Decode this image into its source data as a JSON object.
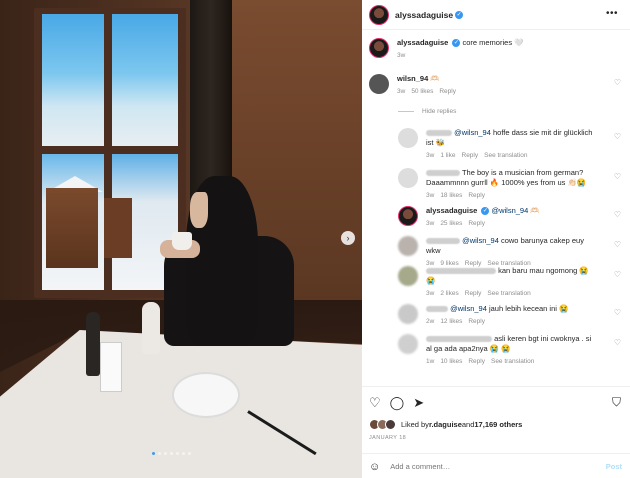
{
  "post": {
    "username": "alyssadaguise",
    "caption_user": "alyssadaguise",
    "caption_text": "core memories 🤍",
    "caption_time": "3w",
    "more_glyph": "•••"
  },
  "comments": [
    {
      "user": "wilsn_94",
      "text": "🫶🏻",
      "time": "3w",
      "likes": "50 likes",
      "reply": "Reply"
    },
    {
      "hide_replies": "Hide replies"
    },
    {
      "user": "",
      "mention": "@wilsn_94",
      "text": " hoffe dass sie mit dir glücklich ist 🐝",
      "time": "3w",
      "likes": "1 like",
      "reply": "Reply",
      "see_translation": "See translation"
    },
    {
      "user": "",
      "text": "The boy is a musician from german? Daaammnnn gurrll 🔥 1000% yes from us 👏🏻😭",
      "time": "3w",
      "likes": "18 likes",
      "reply": "Reply"
    },
    {
      "user": "alyssadaguise",
      "mention": "@wilsn_94",
      "text": " 🫶🏻",
      "time": "3w",
      "likes": "25 likes",
      "reply": "Reply"
    },
    {
      "user": "",
      "mention": "@wilsn_94",
      "text": " cowo barunya cakep euy wkw",
      "time": "3w",
      "likes": "9 likes",
      "reply": "Reply",
      "see_translation": "See translation"
    },
    {
      "user": "",
      "text": "kan baru mau ngomong 😭 😭",
      "time": "3w",
      "likes": "2 likes",
      "reply": "Reply",
      "see_translation": "See translation"
    },
    {
      "user": "",
      "mention": "@wilsn_94",
      "text": " jauh lebih kecean ini 😭",
      "time": "2w",
      "likes": "12 likes",
      "reply": "Reply"
    },
    {
      "user": "",
      "text": "asli keren bgt ini cwoknya . si al ga ada apa2nya 😭 😭",
      "time": "1w",
      "likes": "10 likes",
      "reply": "Reply",
      "see_translation": "See translation"
    }
  ],
  "actions": {
    "liked_by_prefix": "Liked by ",
    "liked_by_user": "r.daguise",
    "liked_by_mid": " and ",
    "liked_by_count": "17,169 others",
    "date": "JANUARY 18",
    "add_comment_placeholder": "Add a comment…",
    "post_label": "Post"
  },
  "icons": {
    "heart": "♡",
    "comment": "◯",
    "share": "➤",
    "save": "⛉",
    "emoji": "☺",
    "next": "›"
  },
  "colors": {
    "link": "#00376b",
    "verified": "#3897f0",
    "post_disabled": "#b2dffc",
    "muted": "#8e8e8e"
  }
}
